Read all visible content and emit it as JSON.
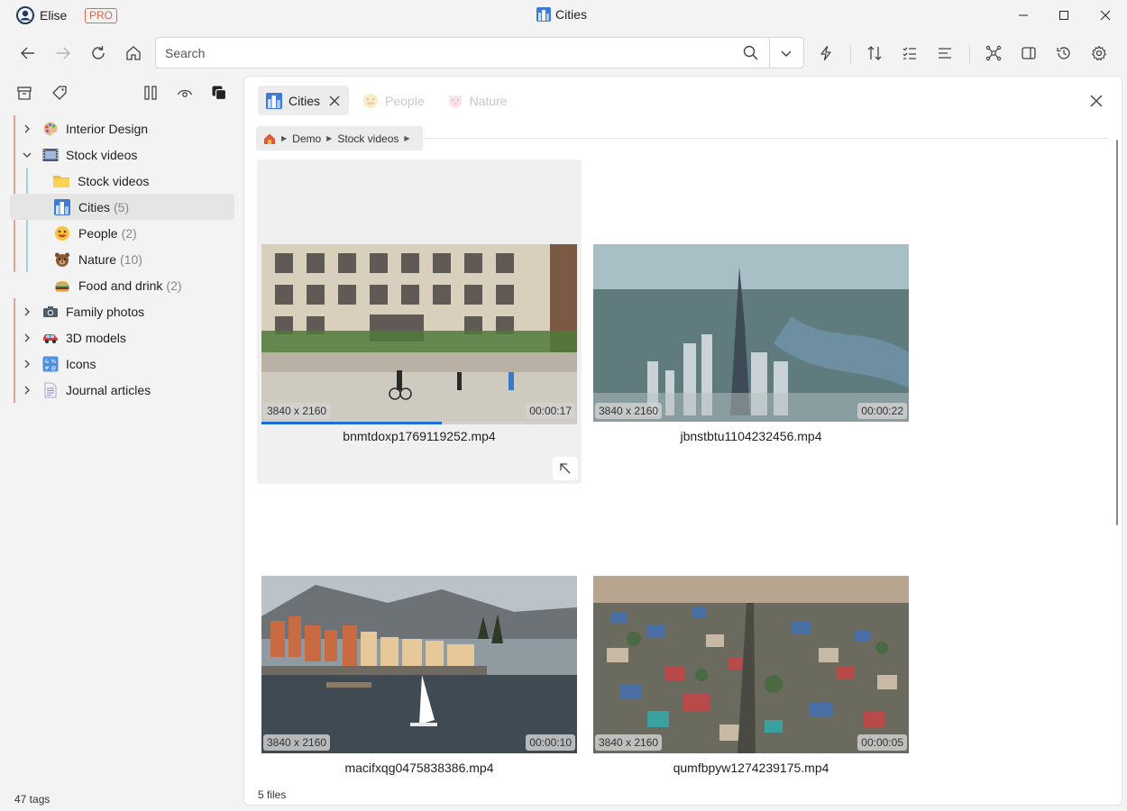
{
  "window": {
    "user_name": "Elise",
    "pro_label": "PRO",
    "title": "Cities"
  },
  "search": {
    "placeholder": "Search"
  },
  "sidebar": {
    "tree": [
      {
        "label": "Interior Design",
        "count": "",
        "icon": "palette-icon",
        "expanded": false
      },
      {
        "label": "Stock videos",
        "count": "",
        "icon": "film-strip-icon",
        "expanded": true
      },
      {
        "label": "Stock videos",
        "count": "",
        "icon": "folder-icon",
        "child": true
      },
      {
        "label": "Cities",
        "count": "(5)",
        "icon": "cityscape-icon",
        "child": true,
        "selected": true
      },
      {
        "label": "People",
        "count": "(2)",
        "icon": "smiley-face-icon",
        "child": true
      },
      {
        "label": "Nature",
        "count": "(10)",
        "icon": "bear-face-icon",
        "child": true
      },
      {
        "label": "Food and drink",
        "count": "(2)",
        "icon": "burger-icon",
        "child": true
      },
      {
        "label": "Family photos",
        "count": "",
        "icon": "camera-icon",
        "expanded": false
      },
      {
        "label": "3D models",
        "count": "",
        "icon": "car-icon",
        "expanded": false
      },
      {
        "label": "Icons",
        "count": "",
        "icon": "symbols-icon",
        "expanded": false
      },
      {
        "label": "Journal articles",
        "count": "",
        "icon": "document-icon",
        "expanded": false
      }
    ],
    "tags_count": "47 tags"
  },
  "tabs": [
    {
      "label": "Cities",
      "icon": "cityscape-icon",
      "active": true
    },
    {
      "label": "People",
      "icon": "smiley-face-icon",
      "active": false
    },
    {
      "label": "Nature",
      "icon": "pig-face-icon",
      "active": false
    }
  ],
  "breadcrumb": [
    "Demo",
    "Stock videos"
  ],
  "files": [
    {
      "name": "bnmtdoxp1769119252.mp4",
      "resolution": "3840 x 2160",
      "duration": "00:00:17",
      "hover": true,
      "progress": 0.57
    },
    {
      "name": "jbnstbtu1104232456.mp4",
      "resolution": "3840 x 2160",
      "duration": "00:00:22"
    },
    {
      "name": "macifxqg0475838386.mp4",
      "resolution": "3840 x 2160",
      "duration": "00:00:10"
    },
    {
      "name": "qumfbpyw1274239175.mp4",
      "resolution": "3840 x 2160",
      "duration": "00:00:05"
    }
  ],
  "status": {
    "files_count": "5 files"
  },
  "colors": {
    "accent": "#1a6fd6",
    "pro": "#e2694d"
  }
}
